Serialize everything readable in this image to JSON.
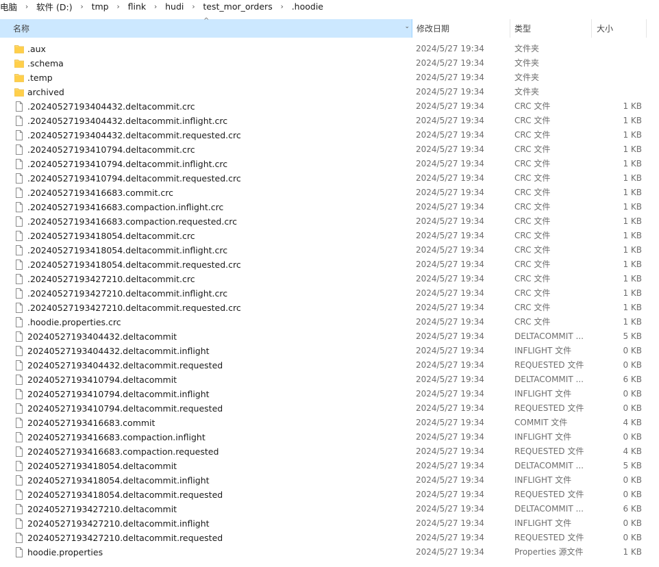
{
  "breadcrumb": [
    "电脑",
    "软件 (D:)",
    "tmp",
    "flink",
    "hudi",
    "test_mor_orders",
    ".hoodie"
  ],
  "columns": {
    "name": "名称",
    "date": "修改日期",
    "type": "类型",
    "size": "大小"
  },
  "files": [
    {
      "name": ".aux",
      "date": "2024/5/27 19:34",
      "type": "文件夹",
      "size": "",
      "kind": "folder"
    },
    {
      "name": ".schema",
      "date": "2024/5/27 19:34",
      "type": "文件夹",
      "size": "",
      "kind": "folder"
    },
    {
      "name": ".temp",
      "date": "2024/5/27 19:34",
      "type": "文件夹",
      "size": "",
      "kind": "folder"
    },
    {
      "name": "archived",
      "date": "2024/5/27 19:34",
      "type": "文件夹",
      "size": "",
      "kind": "folder"
    },
    {
      "name": ".20240527193404432.deltacommit.crc",
      "date": "2024/5/27 19:34",
      "type": "CRC 文件",
      "size": "1 KB",
      "kind": "file"
    },
    {
      "name": ".20240527193404432.deltacommit.inflight.crc",
      "date": "2024/5/27 19:34",
      "type": "CRC 文件",
      "size": "1 KB",
      "kind": "file"
    },
    {
      "name": ".20240527193404432.deltacommit.requested.crc",
      "date": "2024/5/27 19:34",
      "type": "CRC 文件",
      "size": "1 KB",
      "kind": "file"
    },
    {
      "name": ".20240527193410794.deltacommit.crc",
      "date": "2024/5/27 19:34",
      "type": "CRC 文件",
      "size": "1 KB",
      "kind": "file"
    },
    {
      "name": ".20240527193410794.deltacommit.inflight.crc",
      "date": "2024/5/27 19:34",
      "type": "CRC 文件",
      "size": "1 KB",
      "kind": "file"
    },
    {
      "name": ".20240527193410794.deltacommit.requested.crc",
      "date": "2024/5/27 19:34",
      "type": "CRC 文件",
      "size": "1 KB",
      "kind": "file"
    },
    {
      "name": ".20240527193416683.commit.crc",
      "date": "2024/5/27 19:34",
      "type": "CRC 文件",
      "size": "1 KB",
      "kind": "file"
    },
    {
      "name": ".20240527193416683.compaction.inflight.crc",
      "date": "2024/5/27 19:34",
      "type": "CRC 文件",
      "size": "1 KB",
      "kind": "file"
    },
    {
      "name": ".20240527193416683.compaction.requested.crc",
      "date": "2024/5/27 19:34",
      "type": "CRC 文件",
      "size": "1 KB",
      "kind": "file"
    },
    {
      "name": ".20240527193418054.deltacommit.crc",
      "date": "2024/5/27 19:34",
      "type": "CRC 文件",
      "size": "1 KB",
      "kind": "file"
    },
    {
      "name": ".20240527193418054.deltacommit.inflight.crc",
      "date": "2024/5/27 19:34",
      "type": "CRC 文件",
      "size": "1 KB",
      "kind": "file"
    },
    {
      "name": ".20240527193418054.deltacommit.requested.crc",
      "date": "2024/5/27 19:34",
      "type": "CRC 文件",
      "size": "1 KB",
      "kind": "file"
    },
    {
      "name": ".20240527193427210.deltacommit.crc",
      "date": "2024/5/27 19:34",
      "type": "CRC 文件",
      "size": "1 KB",
      "kind": "file"
    },
    {
      "name": ".20240527193427210.deltacommit.inflight.crc",
      "date": "2024/5/27 19:34",
      "type": "CRC 文件",
      "size": "1 KB",
      "kind": "file"
    },
    {
      "name": ".20240527193427210.deltacommit.requested.crc",
      "date": "2024/5/27 19:34",
      "type": "CRC 文件",
      "size": "1 KB",
      "kind": "file"
    },
    {
      "name": ".hoodie.properties.crc",
      "date": "2024/5/27 19:34",
      "type": "CRC 文件",
      "size": "1 KB",
      "kind": "file"
    },
    {
      "name": "20240527193404432.deltacommit",
      "date": "2024/5/27 19:34",
      "type": "DELTACOMMIT ...",
      "size": "5 KB",
      "kind": "file"
    },
    {
      "name": "20240527193404432.deltacommit.inflight",
      "date": "2024/5/27 19:34",
      "type": "INFLIGHT 文件",
      "size": "0 KB",
      "kind": "file"
    },
    {
      "name": "20240527193404432.deltacommit.requested",
      "date": "2024/5/27 19:34",
      "type": "REQUESTED 文件",
      "size": "0 KB",
      "kind": "file"
    },
    {
      "name": "20240527193410794.deltacommit",
      "date": "2024/5/27 19:34",
      "type": "DELTACOMMIT ...",
      "size": "6 KB",
      "kind": "file"
    },
    {
      "name": "20240527193410794.deltacommit.inflight",
      "date": "2024/5/27 19:34",
      "type": "INFLIGHT 文件",
      "size": "0 KB",
      "kind": "file"
    },
    {
      "name": "20240527193410794.deltacommit.requested",
      "date": "2024/5/27 19:34",
      "type": "REQUESTED 文件",
      "size": "0 KB",
      "kind": "file"
    },
    {
      "name": "20240527193416683.commit",
      "date": "2024/5/27 19:34",
      "type": "COMMIT 文件",
      "size": "4 KB",
      "kind": "file"
    },
    {
      "name": "20240527193416683.compaction.inflight",
      "date": "2024/5/27 19:34",
      "type": "INFLIGHT 文件",
      "size": "0 KB",
      "kind": "file"
    },
    {
      "name": "20240527193416683.compaction.requested",
      "date": "2024/5/27 19:34",
      "type": "REQUESTED 文件",
      "size": "4 KB",
      "kind": "file"
    },
    {
      "name": "20240527193418054.deltacommit",
      "date": "2024/5/27 19:34",
      "type": "DELTACOMMIT ...",
      "size": "5 KB",
      "kind": "file"
    },
    {
      "name": "20240527193418054.deltacommit.inflight",
      "date": "2024/5/27 19:34",
      "type": "INFLIGHT 文件",
      "size": "0 KB",
      "kind": "file"
    },
    {
      "name": "20240527193418054.deltacommit.requested",
      "date": "2024/5/27 19:34",
      "type": "REQUESTED 文件",
      "size": "0 KB",
      "kind": "file"
    },
    {
      "name": "20240527193427210.deltacommit",
      "date": "2024/5/27 19:34",
      "type": "DELTACOMMIT ...",
      "size": "6 KB",
      "kind": "file"
    },
    {
      "name": "20240527193427210.deltacommit.inflight",
      "date": "2024/5/27 19:34",
      "type": "INFLIGHT 文件",
      "size": "0 KB",
      "kind": "file"
    },
    {
      "name": "20240527193427210.deltacommit.requested",
      "date": "2024/5/27 19:34",
      "type": "REQUESTED 文件",
      "size": "0 KB",
      "kind": "file"
    },
    {
      "name": "hoodie.properties",
      "date": "2024/5/27 19:34",
      "type": "Properties 源文件",
      "size": "1 KB",
      "kind": "file"
    }
  ]
}
